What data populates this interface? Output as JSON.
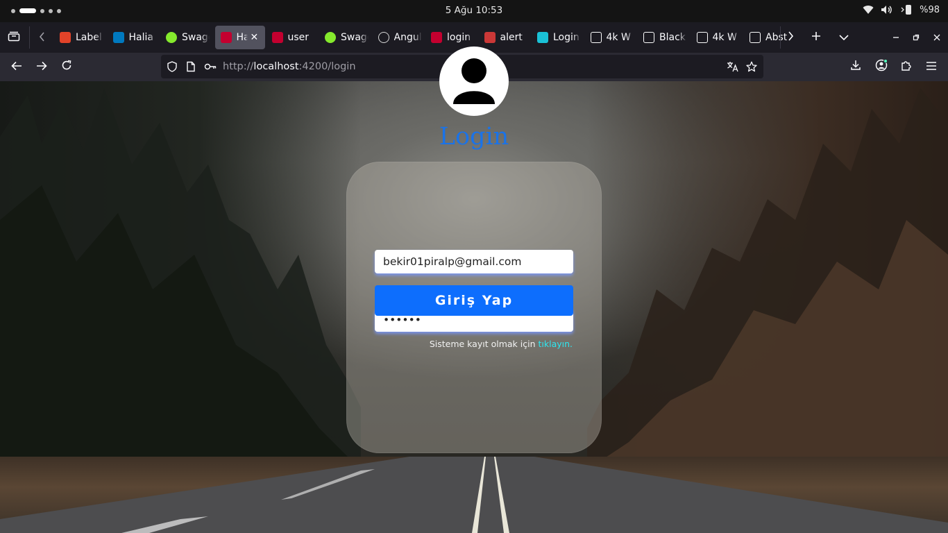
{
  "system": {
    "clock": "5 Ağu  10:53",
    "battery": "%98"
  },
  "tabs": [
    {
      "title": "Label",
      "icon": "gitlab-icon",
      "color": "#e24329"
    },
    {
      "title": "Halia",
      "icon": "trello-icon",
      "color": "#0079bf"
    },
    {
      "title": "Swagger",
      "icon": "swagger-icon",
      "color": "#85ea2d"
    },
    {
      "title": "Ha",
      "icon": "angular-icon",
      "color": "#c3002f",
      "active": true
    },
    {
      "title": "user",
      "icon": "angular-icon",
      "color": "#c3002f"
    },
    {
      "title": "Swagger",
      "icon": "swagger-icon",
      "color": "#85ea2d"
    },
    {
      "title": "Angular",
      "icon": "openai-icon",
      "color": "#d8d8d8"
    },
    {
      "title": "login",
      "icon": "angular-icon",
      "color": "#c3002f"
    },
    {
      "title": "alert",
      "icon": "npm-icon",
      "color": "#cb3837"
    },
    {
      "title": "Login",
      "icon": "vuetify-icon",
      "color": "#1ac1d6"
    },
    {
      "title": "4k W",
      "icon": "pexels-icon",
      "color": "#ffffff"
    },
    {
      "title": "Black",
      "icon": "pexels-icon",
      "color": "#ffffff"
    },
    {
      "title": "4k W",
      "icon": "istock-icon",
      "color": "#ffffff"
    },
    {
      "title": "Abst",
      "icon": "istock-icon",
      "color": "#ffffff"
    }
  ],
  "address": {
    "protocol": "http://",
    "host": "localhost",
    "path": ":4200/login"
  },
  "login": {
    "title": "Login",
    "email_value": "bekir01piralp@gmail.com",
    "password_value": "••••••",
    "submit_label": "Giriş Yap",
    "register_text": "Sisteme kayıt olmak için ",
    "register_link": "tıklayın."
  },
  "colors": {
    "accent": "#0d6efd",
    "title": "#1a73e8",
    "link": "#2ee6f0"
  }
}
